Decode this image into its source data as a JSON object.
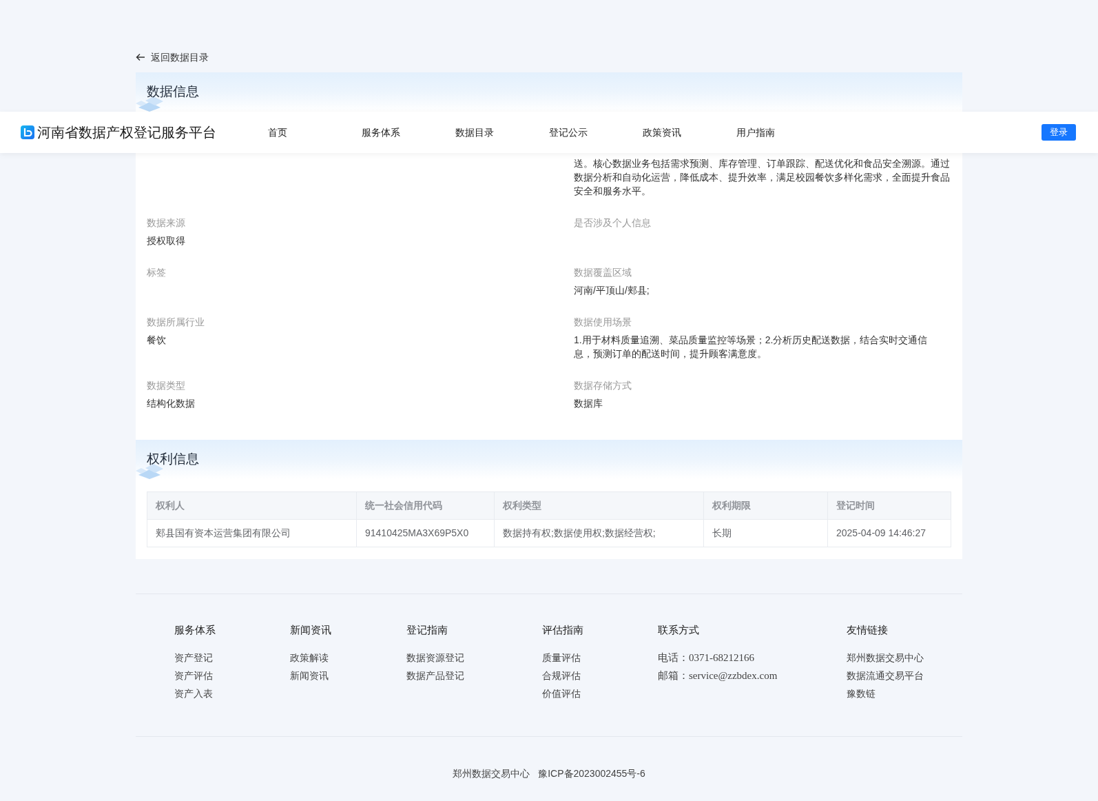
{
  "header": {
    "logo_text": "河南省数据产权登记服务平台",
    "nav": [
      "首页",
      "服务体系",
      "数据目录",
      "登记公示",
      "政策资讯",
      "用户指南"
    ],
    "login_button": "登录"
  },
  "back_link": "返回数据目录",
  "data_info": {
    "title": "数据信息",
    "description": "送。核心数据业务包括需求预测、库存管理、订单跟踪、配送优化和食品安全溯源。通过数据分析和自动化运营，降低成本、提升效率，满足校园餐饮多样化需求，全面提升食品安全和服务水平。",
    "fields": [
      {
        "label": "数据来源",
        "value": "授权取得"
      },
      {
        "label": "是否涉及个人信息"
      },
      {
        "label": "标签"
      },
      {
        "label": "数据覆盖区域",
        "value": "河南/平顶山/郏县;"
      },
      {
        "label": "数据所属行业",
        "value": "餐饮"
      },
      {
        "label": "数据使用场景",
        "value": "1.用于材料质量追溯、菜品质量监控等场景；2.分析历史配送数据，结合实时交通信息，预测订单的配送时间，提升顾客满意度。"
      },
      {
        "label": "数据类型",
        "value": "结构化数据"
      },
      {
        "label": "数据存储方式",
        "value": "数据库"
      }
    ]
  },
  "rights_info": {
    "title": "权利信息",
    "table": {
      "columns": [
        "权利人",
        "统一社会信用代码",
        "权利类型",
        "权利期限",
        "登记时间"
      ],
      "rows": [
        [
          "郏县国有资本运营集团有限公司",
          "91410425MA3X69P5X0",
          "数据持有权;数据使用权;数据经营权;",
          "长期",
          "2025-04-09 14:46:27"
        ]
      ]
    }
  },
  "footer": {
    "columns": [
      {
        "title": "服务体系",
        "links": [
          "资产登记",
          "资产评估",
          "资产入表"
        ]
      },
      {
        "title": "新闻资讯",
        "links": [
          "政策解读",
          "新闻资讯"
        ]
      },
      {
        "title": "登记指南",
        "links": [
          "数据资源登记",
          "数据产品登记"
        ]
      },
      {
        "title": "评估指南",
        "links": [
          "质量评估",
          "合规评估",
          "价值评估"
        ]
      },
      {
        "title": "联系方式",
        "kind": "contact",
        "links": [
          "电话：0371-68212166",
          "邮箱：service@zzbdex.com"
        ]
      },
      {
        "title": "友情链接",
        "links": [
          "郑州数据交易中心",
          "数据流通交易平台",
          "豫数链"
        ]
      }
    ],
    "copyright": [
      "郑州数据交易中心",
      "豫ICP备2023002455号-6"
    ]
  }
}
